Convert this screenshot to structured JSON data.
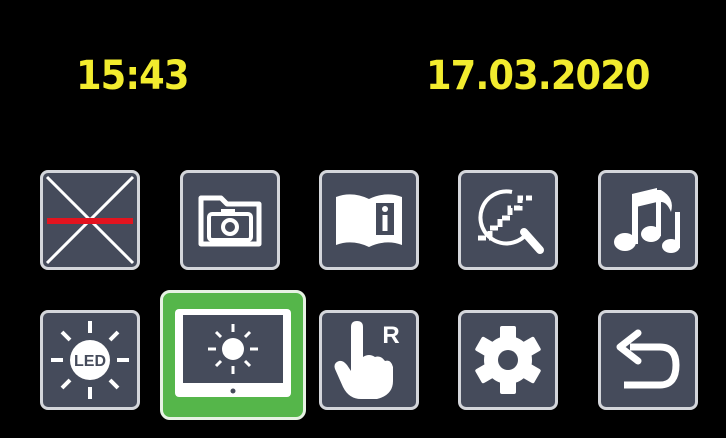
{
  "header": {
    "time": "15:43",
    "date": "17.03.2020"
  },
  "colors": {
    "background": "#000000",
    "header_text": "#f2ec2e",
    "tile_background": "#454b5b",
    "tile_border": "#d4d6db",
    "selected_background": "#55b64a",
    "accent_red": "#e3141f"
  },
  "menu": {
    "row1": [
      {
        "icon": "crosshair-off-icon"
      },
      {
        "icon": "camera-folder-icon"
      },
      {
        "icon": "info-book-icon"
      },
      {
        "icon": "stairs-search-icon"
      },
      {
        "icon": "music-notes-icon"
      }
    ],
    "row2": [
      {
        "icon": "led-light-icon",
        "label": "LED"
      },
      {
        "icon": "screen-brightness-icon",
        "selected": true
      },
      {
        "icon": "right-hand-touch-icon",
        "label": "R"
      },
      {
        "icon": "gear-icon"
      },
      {
        "icon": "back-arrow-icon"
      }
    ]
  }
}
